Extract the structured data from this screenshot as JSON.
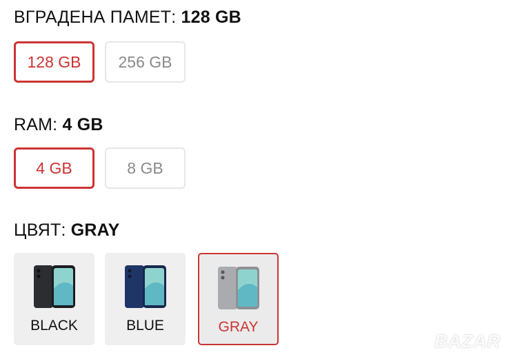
{
  "storage": {
    "label": "ВГРАДЕНА ПАМЕТ:",
    "value": "128 GB",
    "options": [
      {
        "label": "128 GB",
        "selected": true
      },
      {
        "label": "256 GB",
        "selected": false
      }
    ]
  },
  "ram": {
    "label": "RAM:",
    "value": "4 GB",
    "options": [
      {
        "label": "4 GB",
        "selected": true
      },
      {
        "label": "8 GB",
        "selected": false
      }
    ]
  },
  "color": {
    "label": "ЦВЯТ:",
    "value": "GRAY",
    "options": [
      {
        "label": "BLACK",
        "selected": false,
        "swatch": "#2b2d31"
      },
      {
        "label": "BLUE",
        "selected": false,
        "swatch": "#1f3566"
      },
      {
        "label": "GRAY",
        "selected": true,
        "swatch": "#a9abae"
      }
    ]
  },
  "watermark": "BAZAR",
  "accent_color": "#cc3333"
}
